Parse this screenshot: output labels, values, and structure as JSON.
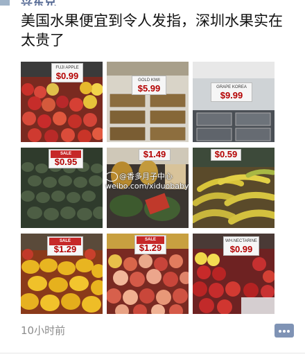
{
  "post": {
    "author_partial": "兴东兄",
    "text": "美国水果便宜到令人发指，深圳水果实在太贵了",
    "time": "10小时前"
  },
  "images": [
    {
      "name": "fuji-apples",
      "tag": {
        "top": "FUJI APPLE",
        "price": "$0.99"
      }
    },
    {
      "name": "gold-kiwi",
      "tag": {
        "top": "GOLD KIWI",
        "price": "$5.99"
      }
    },
    {
      "name": "grape-korea",
      "tag": {
        "top": "GRAPE KOREA",
        "price": "$9.99"
      }
    },
    {
      "name": "avocados",
      "tag": {
        "top": "SALE",
        "price": "$0.95"
      }
    },
    {
      "name": "pineapple-papaya",
      "tag": {
        "top": "",
        "price": "$1.49"
      }
    },
    {
      "name": "bananas",
      "tag": {
        "top": "",
        "price": "$0.59"
      }
    },
    {
      "name": "mangoes",
      "tag": {
        "top": "SALE",
        "price": "$1.29"
      }
    },
    {
      "name": "peaches",
      "tag": {
        "top": "SALE",
        "price": "$1.29"
      }
    },
    {
      "name": "nectarines",
      "tag": {
        "top": "WH.NECTARINE",
        "price": "$0.99"
      }
    }
  ],
  "watermark": {
    "line1": "@香多月子中心",
    "line2": "weibo.com/xiduobaby"
  },
  "icons": {
    "comment": "comment-icon",
    "avatar": "avatar"
  },
  "colors": {
    "text": "#111111",
    "time": "#8c8c8c",
    "link": "#576b95",
    "comment_button": "#7f93b5"
  }
}
